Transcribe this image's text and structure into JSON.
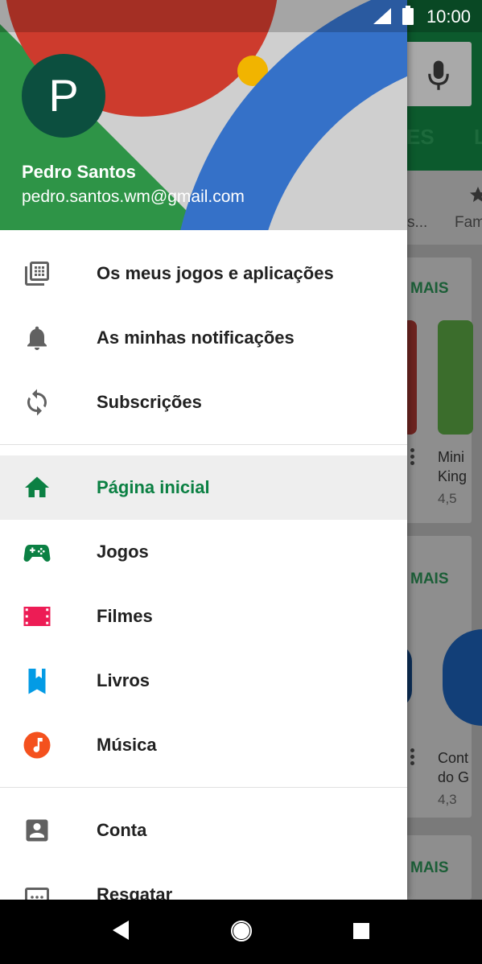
{
  "status_bar": {
    "time": "10:00"
  },
  "account": {
    "avatar_letter": "P",
    "name": "Pedro Santos",
    "email": "pedro.santos.wm@gmail.com"
  },
  "menu": {
    "group1": [
      {
        "label": "Os meus jogos e aplicações",
        "icon": "library-icon"
      },
      {
        "label": "As minhas notificações",
        "icon": "bell-icon"
      },
      {
        "label": "Subscrições",
        "icon": "refresh-icon"
      }
    ],
    "group2": [
      {
        "label": "Página inicial",
        "icon": "home-icon",
        "active": true,
        "color": "#0b8043"
      },
      {
        "label": "Jogos",
        "icon": "gamepad-icon",
        "color": "#0b8043"
      },
      {
        "label": "Filmes",
        "icon": "film-icon",
        "color": "#ed1c55"
      },
      {
        "label": "Livros",
        "icon": "book-icon",
        "color": "#039be5"
      },
      {
        "label": "Música",
        "icon": "music-icon",
        "color": "#f4511e"
      }
    ],
    "group3": [
      {
        "label": "Conta",
        "icon": "account-box-icon"
      },
      {
        "label": "Resgatar",
        "icon": "redeem-icon"
      }
    ]
  },
  "background": {
    "tab_partial_1": "ES",
    "tab_partial_2": "L",
    "category_partial_1": "s...",
    "category_partial_2": "Fam",
    "section_more_1": "MAIS",
    "section_more_2": "MAIS",
    "section_more_3": "MAIS",
    "card1_title_line1": "Mini",
    "card1_title_line2": "King",
    "card1_rating": "4,5",
    "card2_title_line1": "Cont",
    "card2_title_line2": "do G",
    "card2_rating": "4,3"
  }
}
